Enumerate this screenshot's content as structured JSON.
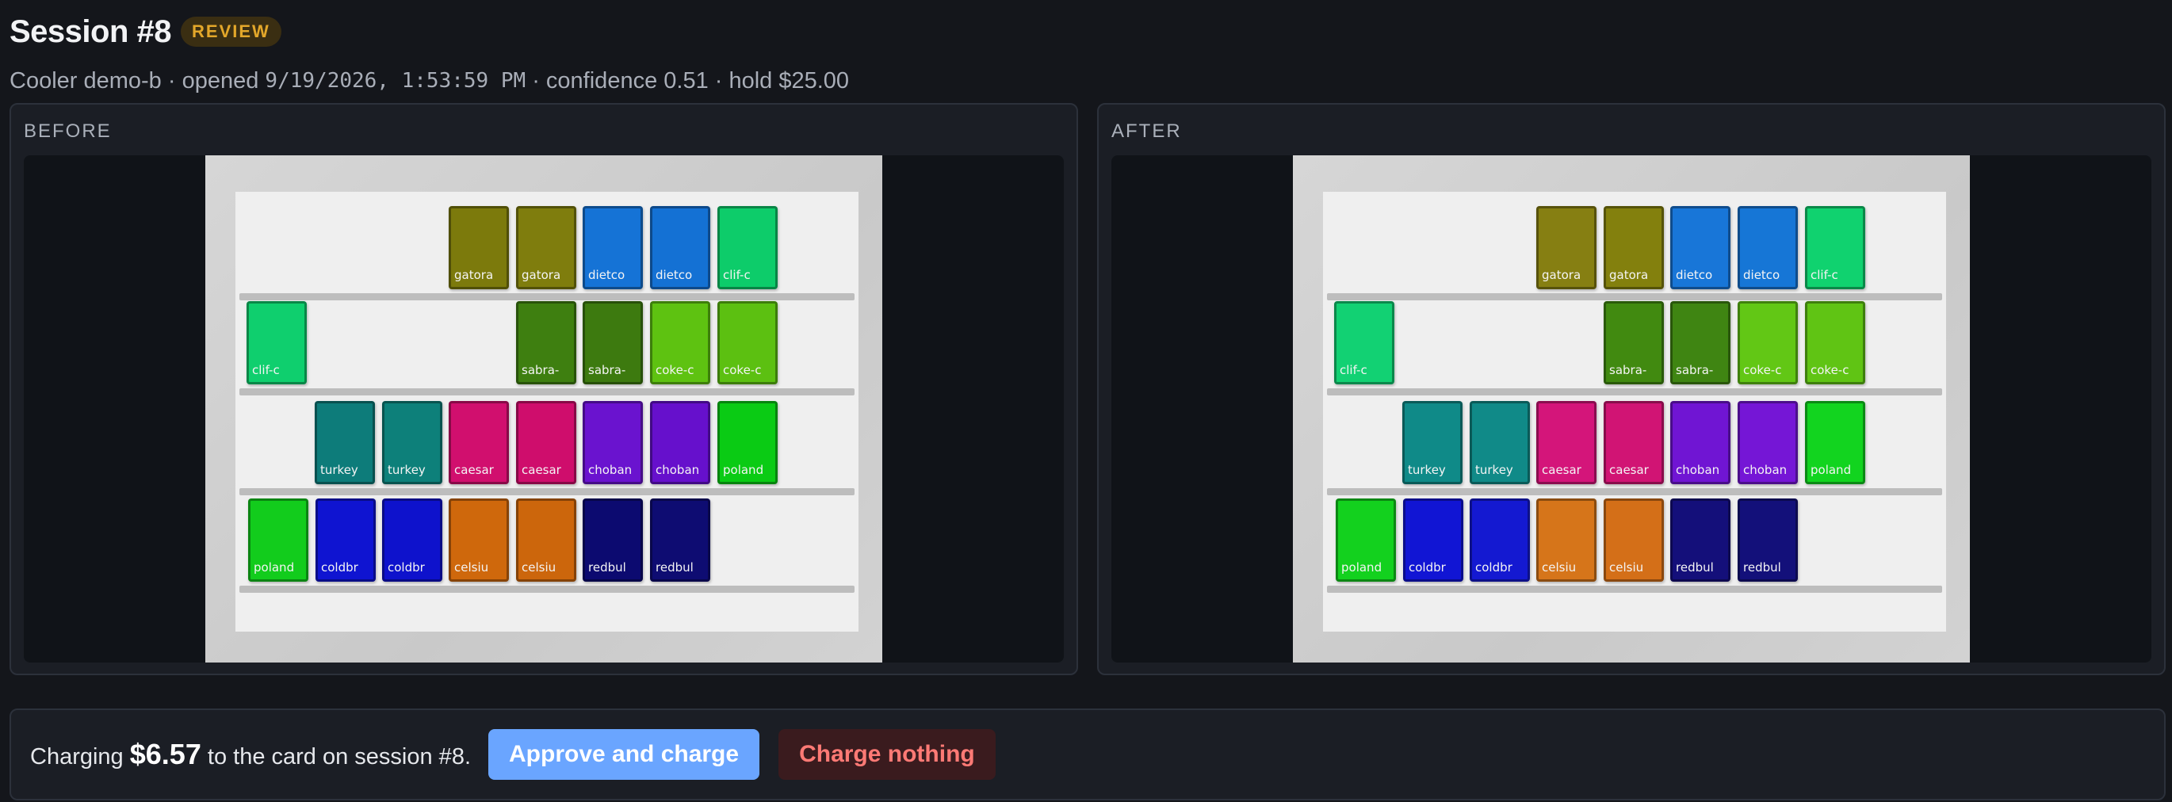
{
  "session": {
    "title": "Session #8",
    "status_badge": "REVIEW",
    "meta_prefix": "Cooler demo-b · opened ",
    "opened_at": "9/19/2026, 1:53:59 PM",
    "meta_suffix": " · confidence 0.51 · hold $25.00"
  },
  "panels": {
    "before_label": "BEFORE",
    "after_label": "AFTER"
  },
  "shelves": {
    "before": [
      [
        {
          "label": "gatora",
          "color": "#7c7a0c"
        },
        {
          "label": "gatora",
          "color": "#7f7d0d"
        },
        {
          "label": "dietco",
          "color": "#1573d6"
        },
        {
          "label": "dietco",
          "color": "#1471d4"
        },
        {
          "label": "clif-c",
          "color": "#0dcc6a"
        }
      ],
      [
        {
          "label": "clif-c",
          "color": "#0fcf6e"
        },
        {
          "label": "sabra-",
          "color": "#3e7f10"
        },
        {
          "label": "sabra-",
          "color": "#3d7a0f"
        },
        {
          "label": "coke-c",
          "color": "#5ec211"
        },
        {
          "label": "coke-c",
          "color": "#5cc011"
        }
      ],
      [
        {
          "label": "turkey",
          "color": "#0d7c7a"
        },
        {
          "label": "turkey",
          "color": "#0d807a"
        },
        {
          "label": "caesar",
          "color": "#d10f6e"
        },
        {
          "label": "caesar",
          "color": "#cf0d6c"
        },
        {
          "label": "choban",
          "color": "#6a13cf"
        },
        {
          "label": "choban",
          "color": "#6610cc"
        },
        {
          "label": "poland",
          "color": "#0acb14"
        }
      ],
      [
        {
          "label": "poland",
          "color": "#12cc1c"
        },
        {
          "label": "coldbr",
          "color": "#0f14d1"
        },
        {
          "label": "coldbr",
          "color": "#0e12cc"
        },
        {
          "label": "celsiu",
          "color": "#cf680c"
        },
        {
          "label": "celsiu",
          "color": "#cc660c"
        },
        {
          "label": "redbul",
          "color": "#0c0a70"
        },
        {
          "label": "redbul",
          "color": "#0e0c72"
        }
      ]
    ],
    "after": [
      [
        {
          "label": "gatora",
          "color": "#867f12"
        },
        {
          "label": "gatora",
          "color": "#83800d"
        },
        {
          "label": "dietco",
          "color": "#1876d8"
        },
        {
          "label": "dietco",
          "color": "#1676d6"
        },
        {
          "label": "clif-c",
          "color": "#10d26f"
        }
      ],
      [
        {
          "label": "clif-c",
          "color": "#12d173"
        },
        {
          "label": "sabra-",
          "color": "#418a10"
        },
        {
          "label": "sabra-",
          "color": "#3f8512"
        },
        {
          "label": "coke-c",
          "color": "#62c715"
        },
        {
          "label": "coke-c",
          "color": "#60c414"
        }
      ],
      [
        {
          "label": "turkey",
          "color": "#0f8a88"
        },
        {
          "label": "turkey",
          "color": "#108a88"
        },
        {
          "label": "caesar",
          "color": "#d4157a"
        },
        {
          "label": "caesar",
          "color": "#d11474"
        },
        {
          "label": "choban",
          "color": "#7015d3"
        },
        {
          "label": "choban",
          "color": "#7516d6"
        },
        {
          "label": "poland",
          "color": "#12d41f"
        }
      ],
      [
        {
          "label": "poland",
          "color": "#13d11e"
        },
        {
          "label": "coldbr",
          "color": "#1115d4"
        },
        {
          "label": "coldbr",
          "color": "#1419d1"
        },
        {
          "label": "celsiu",
          "color": "#d6751a"
        },
        {
          "label": "celsiu",
          "color": "#d46f18"
        },
        {
          "label": "redbul",
          "color": "#140f7a"
        },
        {
          "label": "redbul",
          "color": "#13107a"
        }
      ]
    ]
  },
  "action": {
    "prefix": "Charging ",
    "amount": "$6.57",
    "suffix": " to the card on session #8.",
    "approve_label": "Approve and charge",
    "reject_label": "Charge nothing"
  }
}
